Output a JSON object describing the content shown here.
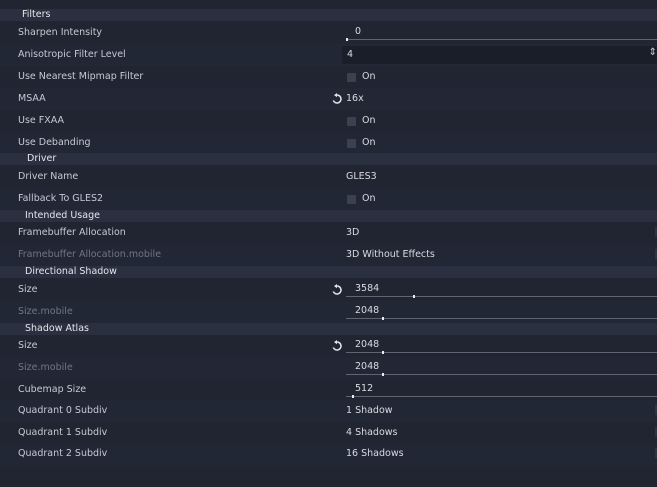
{
  "sections": {
    "filters": "Filters",
    "driver": "Driver",
    "intended_usage": "Intended Usage",
    "directional_shadow": "Directional Shadow",
    "shadow_atlas": "Shadow Atlas"
  },
  "filters": {
    "sharpen_intensity": {
      "label": "Sharpen Intensity",
      "value": "0",
      "fraction": 0.0
    },
    "anisotropic_filter_level": {
      "label": "Anisotropic Filter Level",
      "value": "4"
    },
    "use_nearest_mipmap_filter": {
      "label": "Use Nearest Mipmap Filter",
      "value": "On",
      "checked": false
    },
    "msaa": {
      "label": "MSAA",
      "value": "16x"
    },
    "use_fxaa": {
      "label": "Use FXAA",
      "value": "On",
      "checked": false
    },
    "use_debanding": {
      "label": "Use Debanding",
      "value": "On",
      "checked": false
    }
  },
  "driver": {
    "driver_name": {
      "label": "Driver Name",
      "value": "GLES3"
    },
    "fallback_to_gles2": {
      "label": "Fallback To GLES2",
      "value": "On",
      "checked": false
    }
  },
  "intended_usage": {
    "framebuffer_allocation": {
      "label": "Framebuffer Allocation",
      "value": "3D"
    },
    "framebuffer_allocation_mobile": {
      "label": "Framebuffer Allocation.mobile",
      "value": "3D Without Effects"
    }
  },
  "directional_shadow": {
    "size": {
      "label": "Size",
      "value": "3584",
      "fraction": 0.215
    },
    "size_mobile": {
      "label": "Size.mobile",
      "value": "2048",
      "fraction": 0.115
    }
  },
  "shadow_atlas": {
    "size": {
      "label": "Size",
      "value": "2048",
      "fraction": 0.115
    },
    "size_mobile": {
      "label": "Size.mobile",
      "value": "2048",
      "fraction": 0.115
    },
    "cubemap_size": {
      "label": "Cubemap Size",
      "value": "512",
      "fraction": 0.02
    },
    "quadrant_0_subdiv": {
      "label": "Quadrant 0 Subdiv",
      "value": "1 Shadow"
    },
    "quadrant_1_subdiv": {
      "label": "Quadrant 1 Subdiv",
      "value": "4 Shadows"
    },
    "quadrant_2_subdiv": {
      "label": "Quadrant 2 Subdiv",
      "value": "16 Shadows"
    }
  },
  "icons": {
    "revert": "revert-icon",
    "spin": "spinner-arrows-icon",
    "checkbox": "checkbox-unchecked-icon"
  },
  "colors": {
    "background": "#202531",
    "section": "#2a3040",
    "field": "#1a1e29"
  }
}
